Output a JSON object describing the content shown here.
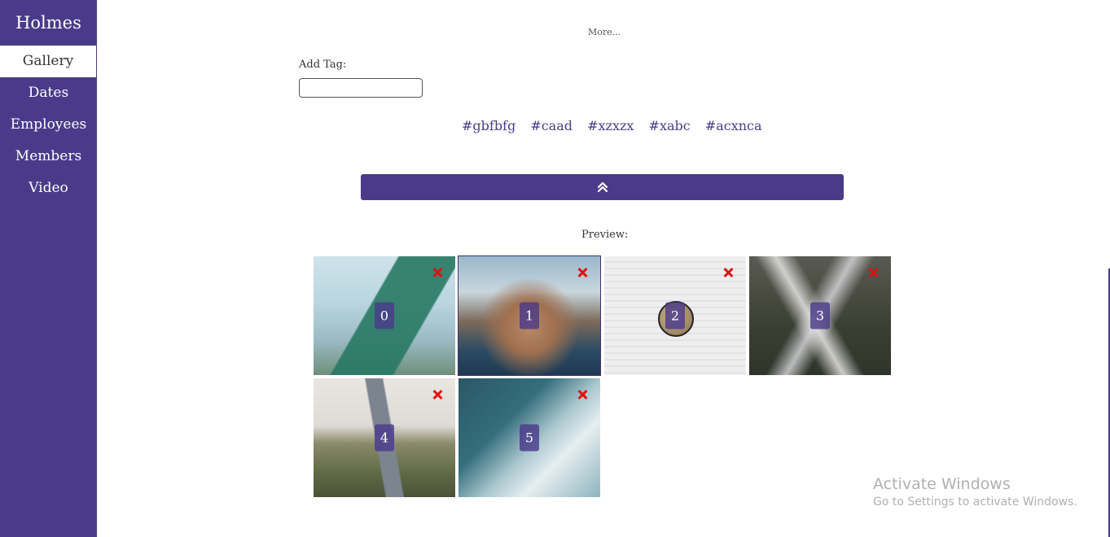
{
  "sidebar": {
    "brand": "Holmes",
    "items": [
      {
        "label": "Gallery"
      },
      {
        "label": "Dates"
      },
      {
        "label": "Employees"
      },
      {
        "label": "Members"
      },
      {
        "label": "Video"
      }
    ],
    "active_item": "Gallery",
    "color": "#4a3b8a"
  },
  "main": {
    "more_link": "More...",
    "add_tag_label": "Add Tag:",
    "tag_input_value": "",
    "tags": [
      "#gbfbfg",
      "#caad",
      "#xzxzx",
      "#xabc",
      "#acxnca"
    ],
    "collapse_icon": "double-chevron-up-icon",
    "preview_label": "Preview:",
    "gallery": [
      {
        "index": "0",
        "selected": false
      },
      {
        "index": "1",
        "selected": true
      },
      {
        "index": "2",
        "selected": false
      },
      {
        "index": "3",
        "selected": false
      },
      {
        "index": "4",
        "selected": false
      },
      {
        "index": "5",
        "selected": false
      }
    ],
    "delete_icon": "close-icon"
  },
  "watermark": {
    "title": "Activate Windows",
    "subtitle": "Go to Settings to activate Windows."
  }
}
